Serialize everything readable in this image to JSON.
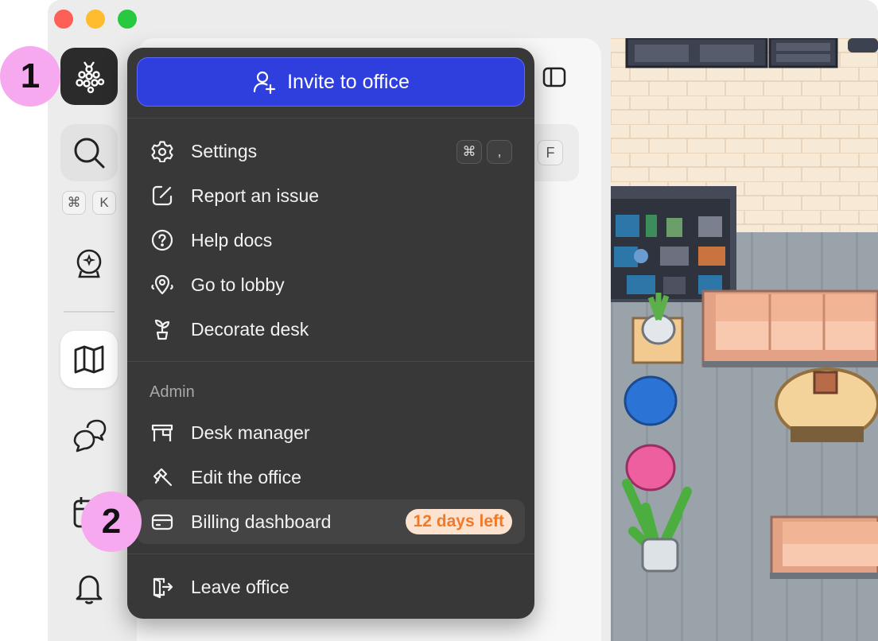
{
  "window": {
    "controls": [
      "close",
      "minimize",
      "zoom"
    ]
  },
  "sidebar": {
    "items": [
      {
        "name": "logo",
        "icon": "office-logo-icon"
      },
      {
        "name": "search",
        "icon": "search-icon",
        "shortcut": [
          "⌘",
          "K"
        ]
      },
      {
        "name": "ai",
        "icon": "crystal-ball-icon"
      },
      {
        "name": "map",
        "icon": "map-icon",
        "active": true
      },
      {
        "name": "chat",
        "icon": "chat-bubbles-icon"
      },
      {
        "name": "calendar",
        "icon": "calendar-icon"
      },
      {
        "name": "notifications",
        "icon": "bell-icon"
      }
    ]
  },
  "panel": {
    "search_shortcut": "F",
    "toggle_icon": "sidebar-toggle-icon"
  },
  "menu": {
    "invite": {
      "label": "Invite to office",
      "icon": "add-user-icon",
      "color": "#2f3fde"
    },
    "items": [
      {
        "label": "Settings",
        "icon": "gear-icon",
        "shortcut": [
          "⌘",
          ","
        ]
      },
      {
        "label": "Report an issue",
        "icon": "edit-icon"
      },
      {
        "label": "Help docs",
        "icon": "question-icon"
      },
      {
        "label": "Go to lobby",
        "icon": "lobby-icon"
      },
      {
        "label": "Decorate desk",
        "icon": "plant-icon"
      }
    ],
    "admin": {
      "title": "Admin",
      "items": [
        {
          "label": "Desk manager",
          "icon": "desk-icon"
        },
        {
          "label": "Edit the office",
          "icon": "hammer-icon"
        },
        {
          "label": "Billing dashboard",
          "icon": "credit-card-icon",
          "badge": "12 days left",
          "highlighted": true
        }
      ]
    },
    "leave": {
      "label": "Leave office",
      "icon": "leave-icon"
    }
  },
  "annotations": [
    {
      "label": "1",
      "color": "#f7a9f0"
    },
    {
      "label": "2",
      "color": "#f7a9f0"
    }
  ]
}
